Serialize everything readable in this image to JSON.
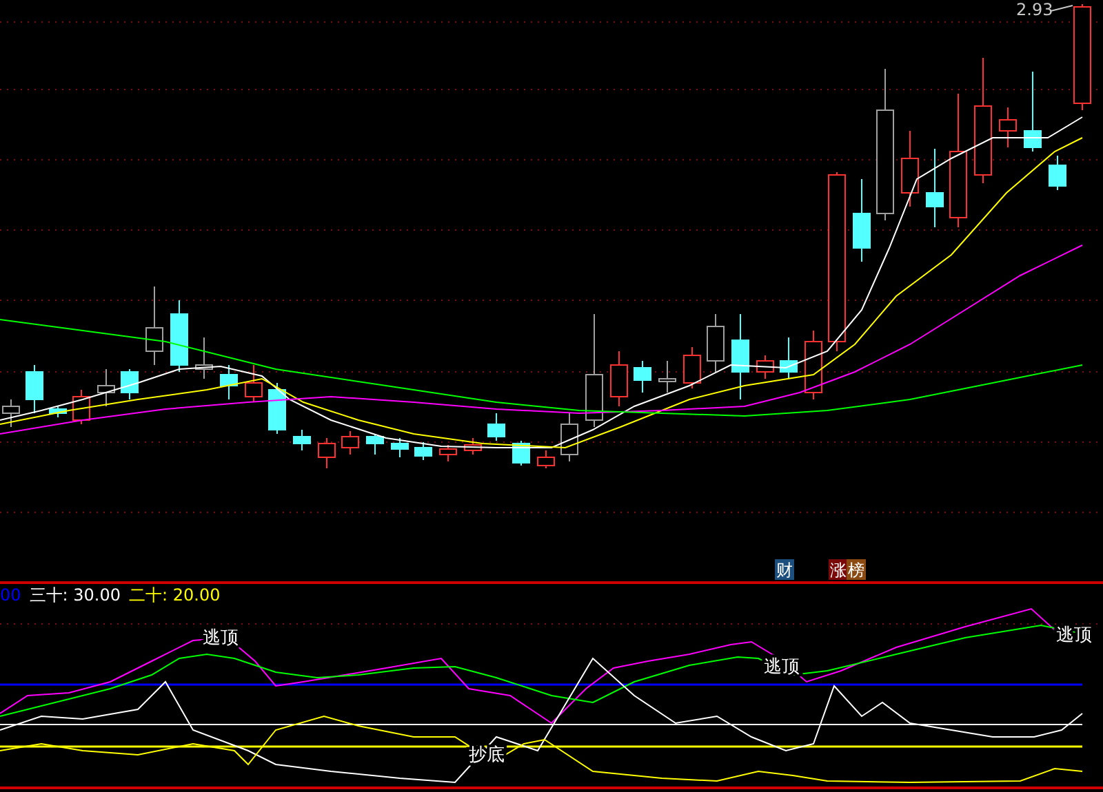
{
  "price_panel": {
    "high_label": "2.93",
    "badges": [
      {
        "text": "财",
        "color": "#1c4f7e"
      },
      {
        "text": "涨",
        "color": "#7a0a0a"
      },
      {
        "text": "榜",
        "color": "#8a4a12"
      }
    ]
  },
  "indicator_panel": {
    "legend": [
      {
        "text": "00",
        "color": "#0000ff"
      },
      {
        "text": "三十: 30.00",
        "color": "#ffffff"
      },
      {
        "text": "二十: 20.00",
        "color": "#ffff00"
      }
    ],
    "signals": [
      {
        "text": "逃顶"
      },
      {
        "text": "逃顶"
      },
      {
        "text": "逃顶"
      },
      {
        "text": "抄底"
      }
    ]
  }
}
